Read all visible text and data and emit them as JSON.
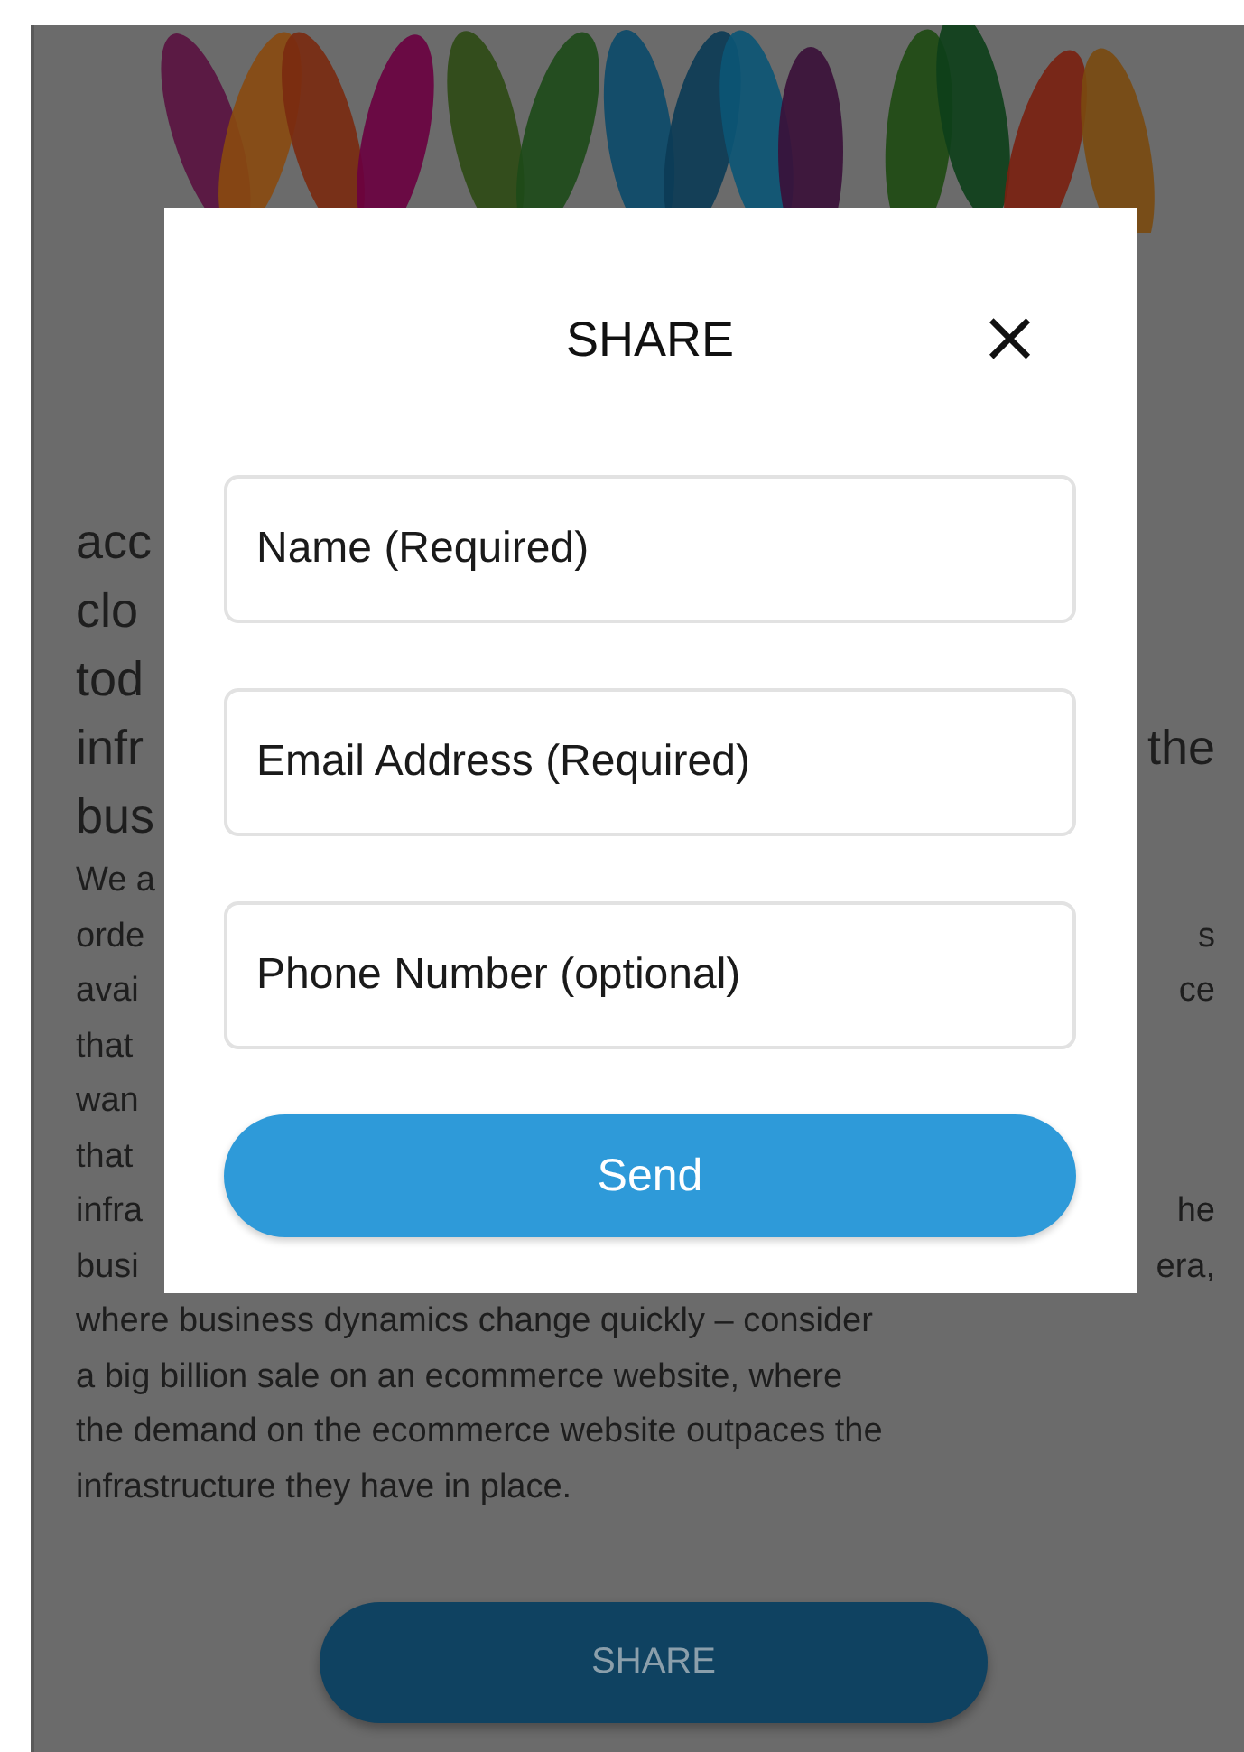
{
  "article": {
    "heading_lines": [
      {
        "left": "acc"
      },
      {
        "left": "clo"
      },
      {
        "left": "tod"
      },
      {
        "left": "infr",
        "right": "the"
      },
      {
        "left": "bus"
      }
    ],
    "body_lines": [
      {
        "left": "We a"
      },
      {
        "left": "orde",
        "right": "s"
      },
      {
        "left": "avai",
        "right": "ce"
      },
      {
        "left": "that"
      },
      {
        "left": "wan"
      },
      {
        "left": "that"
      },
      {
        "left": "infra",
        "right": "he"
      },
      {
        "left": "busi",
        "right": "era,"
      },
      {
        "left": "where business dynamics change quickly – consider"
      },
      {
        "left": "a big billion sale on an ecommerce website, where"
      },
      {
        "left": "the demand on the ecommerce website outpaces the"
      },
      {
        "left": "infrastructure they have in place."
      }
    ]
  },
  "share_button": {
    "label": "SHARE"
  },
  "dialog": {
    "title": "SHARE",
    "close": "×",
    "fields": [
      {
        "placeholder": "Name (Required)"
      },
      {
        "placeholder": "Email Address (Required)"
      },
      {
        "placeholder": "Phone Number (optional)"
      }
    ],
    "submit": "Send"
  }
}
